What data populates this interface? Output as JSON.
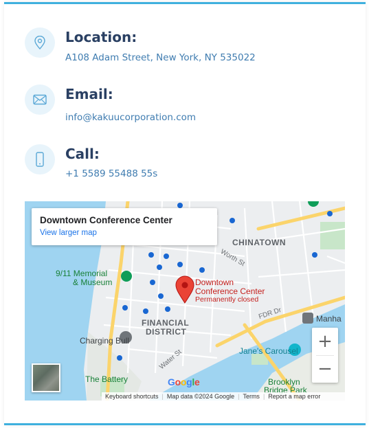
{
  "contact": {
    "location": {
      "title": "Location:",
      "text": "A108 Adam Street, New York, NY 535022",
      "icon": "map-pin-icon"
    },
    "email": {
      "title": "Email:",
      "text": "info@kakuucorporation.com",
      "icon": "envelope-icon"
    },
    "call": {
      "title": "Call:",
      "text": "+1 5589 55488 55s",
      "icon": "phone-icon"
    }
  },
  "map": {
    "infocard": {
      "place": "Downtown Conference Center",
      "link": "View larger map"
    },
    "labels": {
      "chinatown": "CHINATOWN",
      "financial_1": "FINANCIAL",
      "financial_2": "DISTRICT",
      "memorial_1": "9/11 Memorial",
      "memorial_2": "& Museum",
      "pin_1": "Downtown",
      "pin_2": "Conference Center",
      "pin_status": "Permanently closed",
      "bull": "Charging Bull",
      "carousel": "Jane's Carousel",
      "battery": "The Battery",
      "brooklyn_1": "Brooklyn",
      "brooklyn_2": "Bridge Park",
      "manha": "Manha",
      "fdr": "FDR Dr",
      "water": "Water St",
      "worth": "Worth St"
    },
    "zoom_in": "+",
    "zoom_out": "−",
    "attribution": {
      "shortcuts": "Keyboard shortcuts",
      "mapdata": "Map data ©2024 Google",
      "terms": "Terms",
      "report": "Report a map error"
    },
    "colors": {
      "accent": "#3fb0de",
      "pin": "#ea4335",
      "water": "#9fd4f1",
      "road": "#fbd46b"
    }
  }
}
